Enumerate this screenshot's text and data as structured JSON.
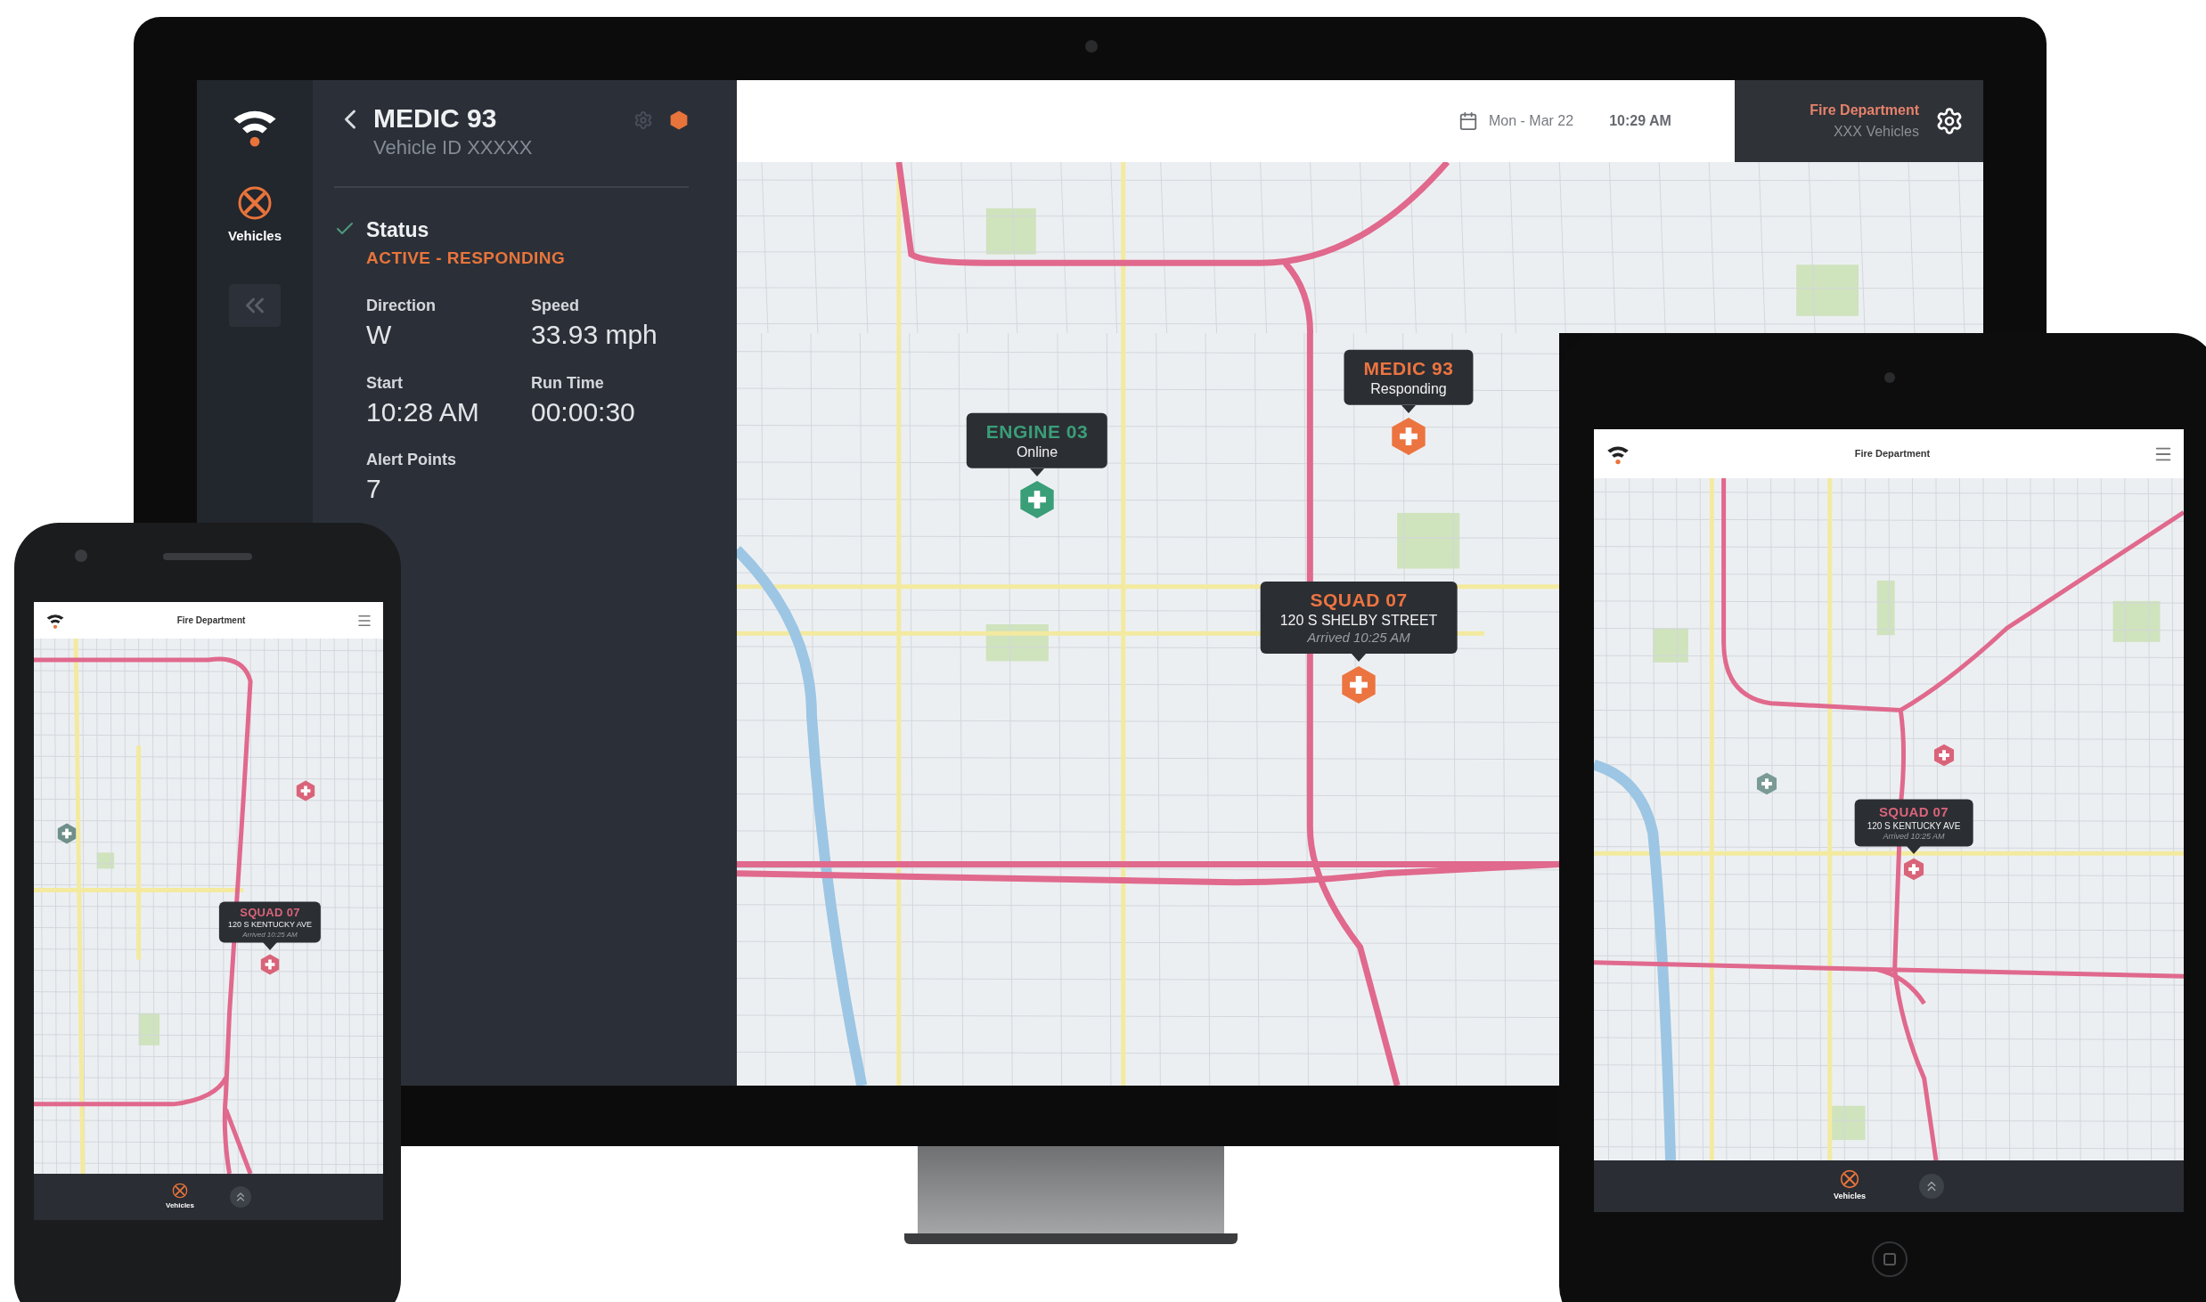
{
  "monitor": {
    "sidebar": {
      "nav_items": [
        {
          "kind": "vehicles",
          "label": "Vehicles",
          "selected": true
        }
      ]
    },
    "detail": {
      "title": "MEDIC 93",
      "subtitle": "Vehicle ID XXXXX",
      "status_label": "Status",
      "status_value": "ACTIVE - RESPONDING",
      "fields": [
        {
          "label": "Direction",
          "value": "W"
        },
        {
          "label": "Speed",
          "value": "33.93 mph"
        },
        {
          "label": "Start",
          "value": "10:28 AM"
        },
        {
          "label": "Run Time",
          "value": "00:00:30"
        },
        {
          "label": "Alert Points",
          "value": "7"
        }
      ]
    },
    "top_bar": {
      "date": "Mon - Mar 22",
      "time": "10:29 AM",
      "account": {
        "name": "Fire Department",
        "detail": "XXX Vehicles"
      }
    },
    "map": {
      "markers": [
        {
          "name": "ENGINE 03",
          "lines": [
            "Online"
          ],
          "color": "#3a9e78"
        },
        {
          "name": "MEDIC 93",
          "lines": [
            "Responding"
          ],
          "color": "#ec7440"
        },
        {
          "name": "SQUAD 07",
          "lines": [
            "120 S SHELBY STREET",
            "Arrived 10:25 AM"
          ],
          "color": "#ec7440"
        }
      ]
    }
  },
  "tablet": {
    "header": {
      "title": "Fire Department"
    },
    "map": {
      "markers": [
        {
          "color": "#d9647a"
        },
        {
          "color": "#7a9a96"
        },
        {
          "name": "SQUAD 07",
          "lines": [
            "120 S KENTUCKY AVE",
            "Arrived 10:25 AM"
          ],
          "color": "#d9647a"
        }
      ]
    },
    "bottom_nav": [
      {
        "kind": "vehicles",
        "label": "Vehicles",
        "selected": true
      },
      {
        "kind": "up",
        "selected": false
      }
    ]
  },
  "phone": {
    "header": {
      "title": "Fire Department"
    },
    "map": {
      "markers": [
        {
          "color": "#d9647a"
        },
        {
          "color": "#6f8f8a"
        },
        {
          "name": "SQUAD 07",
          "lines": [
            "120 S KENTUCKY AVE",
            "Arrived 10:25 AM"
          ],
          "color": "#d9647a"
        }
      ]
    },
    "bottom_nav": [
      {
        "kind": "vehicles",
        "label": "Vehicles",
        "selected": true
      },
      {
        "kind": "up",
        "selected": false
      }
    ]
  }
}
